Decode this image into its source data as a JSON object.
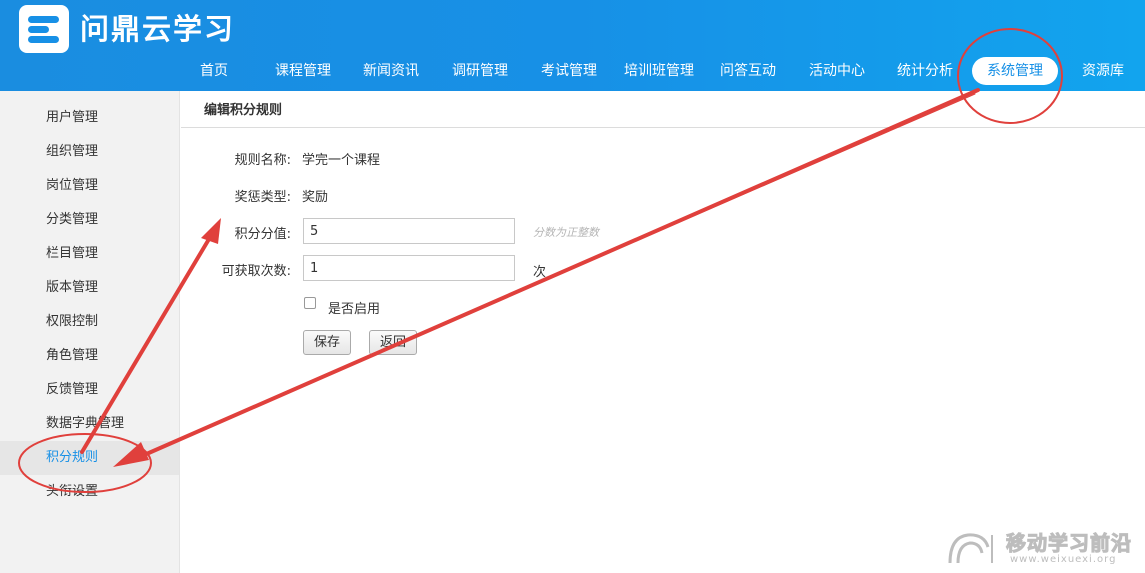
{
  "header": {
    "logo_text": "问鼎云学习",
    "nav": [
      {
        "label": "首页"
      },
      {
        "label": "课程管理"
      },
      {
        "label": "新闻资讯"
      },
      {
        "label": "调研管理"
      },
      {
        "label": "考试管理"
      },
      {
        "label": "培训班管理"
      },
      {
        "label": "问答互动"
      },
      {
        "label": "活动中心"
      },
      {
        "label": "统计分析"
      },
      {
        "label": "系统管理",
        "active": true
      },
      {
        "label": "资源库"
      }
    ]
  },
  "sidebar": {
    "items": [
      {
        "label": "用户管理"
      },
      {
        "label": "组织管理"
      },
      {
        "label": "岗位管理"
      },
      {
        "label": "分类管理"
      },
      {
        "label": "栏目管理"
      },
      {
        "label": "版本管理"
      },
      {
        "label": "权限控制"
      },
      {
        "label": "角色管理"
      },
      {
        "label": "反馈管理"
      },
      {
        "label": "数据字典管理"
      },
      {
        "label": "积分规则",
        "active": true
      },
      {
        "label": "头衔设置"
      }
    ]
  },
  "main": {
    "title": "编辑积分规则",
    "form": {
      "rule_name_label": "规则名称:",
      "rule_name_value": "学完一个课程",
      "type_label": "奖惩类型:",
      "type_value": "奖励",
      "points_label": "积分分值:",
      "points_value": "5",
      "points_hint": "分数为正整数",
      "times_label": "可获取次数:",
      "times_value": "1",
      "times_unit": "次",
      "enable_label": "是否启用",
      "enable_checked": false,
      "save_label": "保存",
      "back_label": "返回"
    }
  },
  "watermark": {
    "text": "移动学习前沿",
    "url": "www.weixuexi.org"
  },
  "colors": {
    "header_blue": "#1790e6",
    "annotation_red": "#e0403c"
  }
}
